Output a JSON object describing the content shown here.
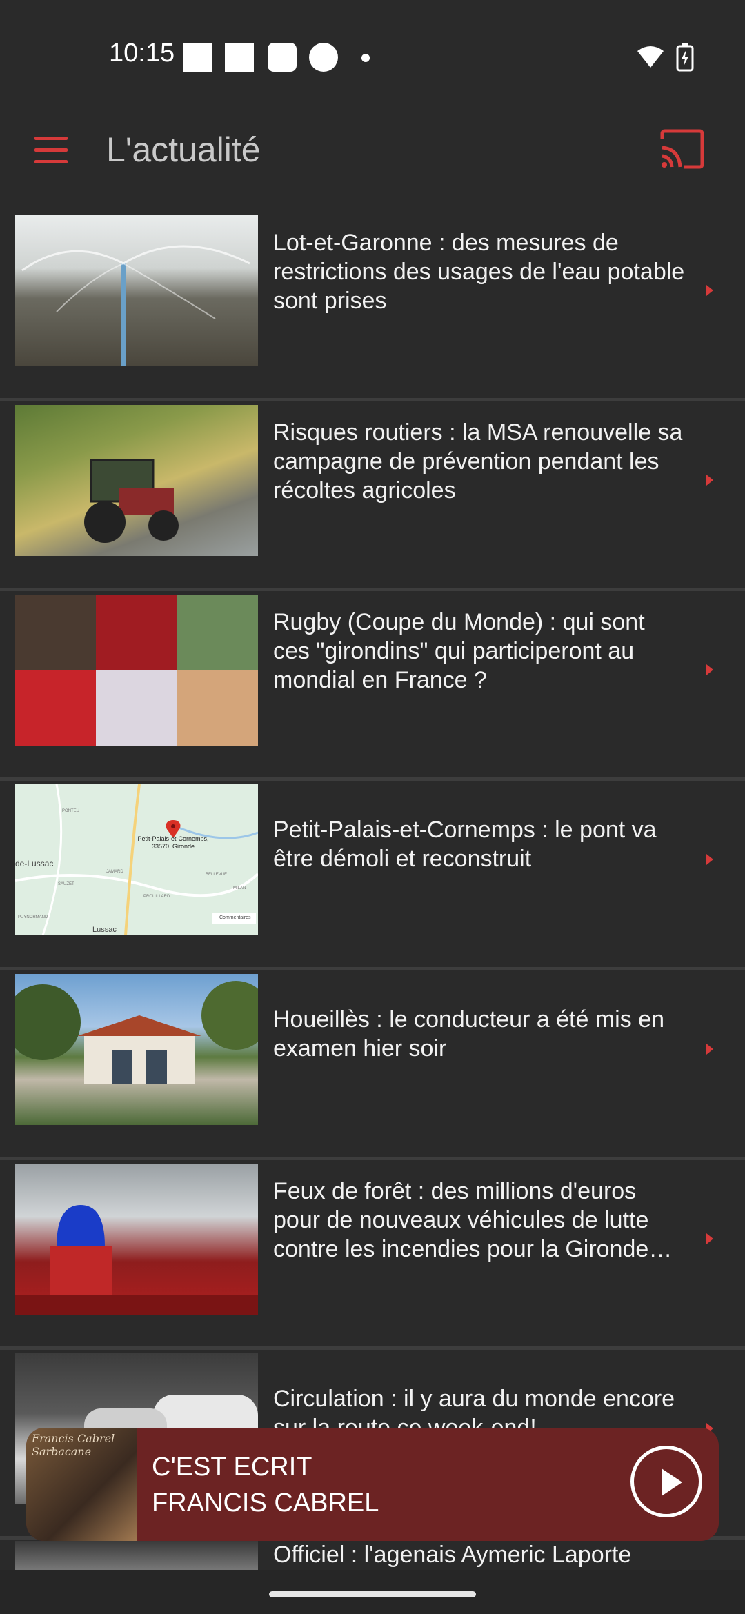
{
  "status_bar": {
    "time": "10:15"
  },
  "app_bar": {
    "title": "L'actualité"
  },
  "news": [
    {
      "title": "Lot-et-Garonne : des mesures de restrictions des usages de l'eau potable sont prises"
    },
    {
      "title": "Risques routiers : la MSA renouvelle sa campagne de prévention pendant les récoltes agricoles"
    },
    {
      "title": "Rugby (Coupe du Monde) : qui sont ces \"girondins\" qui participeront au mondial en France ?"
    },
    {
      "title": "Petit-Palais-et-Cornemps : le pont va être démoli et reconstruit"
    },
    {
      "title": "Houeillès : le conducteur a été mis en examen hier soir"
    },
    {
      "title": "Feux de forêt : des millions d'euros pour de nouveaux véhicules de lutte contre les incendies pour la Gironde…"
    },
    {
      "title": "Circulation : il y aura du monde encore sur la route ce week-end!"
    },
    {
      "title": "Officiel : l'agenais Aymeric Laporte"
    }
  ],
  "map_labels": {
    "pin": "Petit-Palais-et-Cornemps, 33570, Gironde",
    "town_left": "de-Lussac",
    "town_bottom": "Lussac",
    "small1": "PUYNORMAND",
    "small2": "SAUZET",
    "small3": "JAMARD",
    "small4": "BELLEVUE",
    "small5": "PROUILLARD",
    "small6": "MILAN",
    "small7": "PONTEU",
    "small8": "Commentaires"
  },
  "player": {
    "line1": "C'EST ECRIT",
    "line2": "FRANCIS CABREL",
    "cover_text": "Francis Cabrel Sarbacane"
  },
  "colors": {
    "accent": "#d63a3a",
    "player_bg": "#6c2323",
    "background": "#2a2a2a"
  }
}
